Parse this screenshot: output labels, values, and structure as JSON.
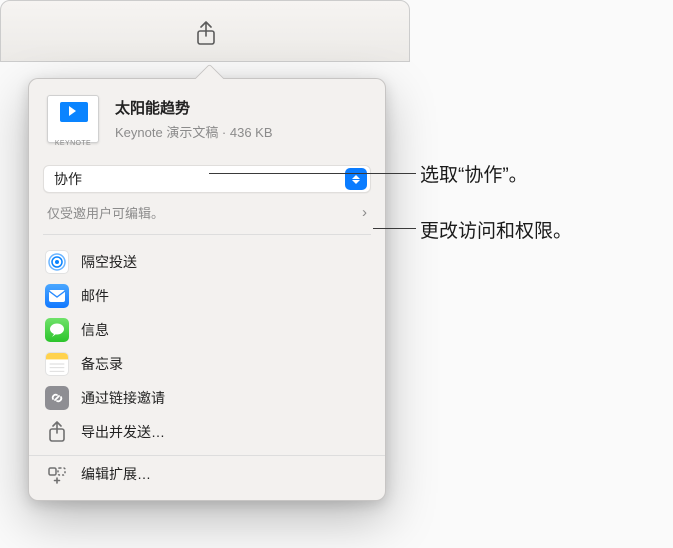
{
  "toolbar": {
    "share_icon": "share-icon"
  },
  "doc": {
    "thumb_label": "KEYNOTE",
    "title": "太阳能趋势",
    "meta": "Keynote 演示文稿 · 436 KB"
  },
  "mode_select": {
    "value": "协作"
  },
  "permissions": {
    "text": "仅受邀用户可编辑。",
    "chevron": "›"
  },
  "apps": [
    {
      "label": "隔空投送",
      "icon_name": "airdrop-icon"
    },
    {
      "label": "邮件",
      "icon_name": "mail-icon"
    },
    {
      "label": "信息",
      "icon_name": "messages-icon"
    },
    {
      "label": "备忘录",
      "icon_name": "notes-icon"
    },
    {
      "label": "通过链接邀请",
      "icon_name": "link-icon"
    },
    {
      "label": "导出并发送…",
      "icon_name": "export-icon"
    }
  ],
  "extensions": {
    "label": "编辑扩展…",
    "icon_name": "extensions-icon"
  },
  "callouts": {
    "select_mode": "选取“协作”。",
    "permissions": "更改访问和权限。"
  }
}
